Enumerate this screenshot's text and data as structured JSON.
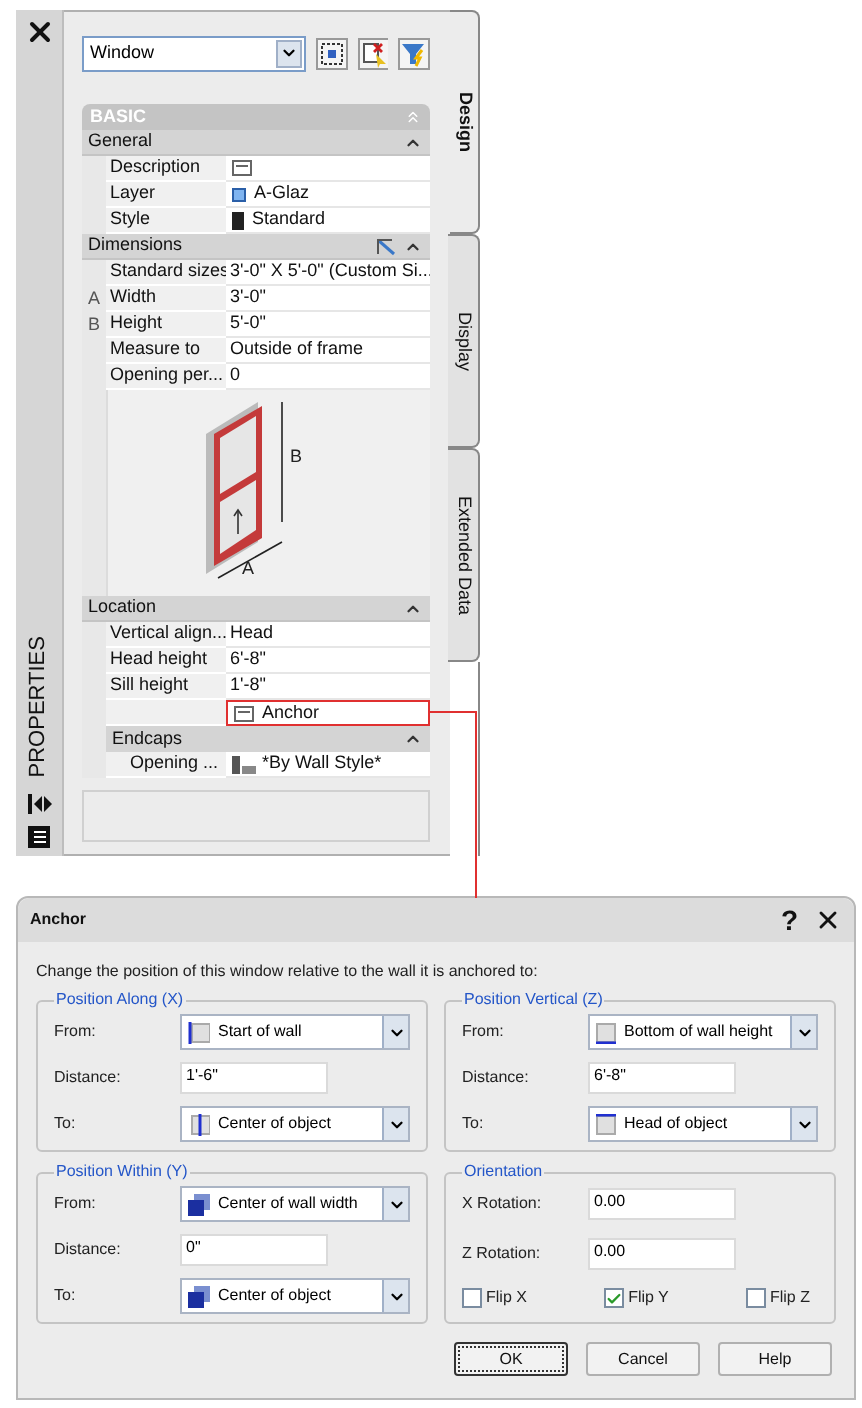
{
  "palette": {
    "title": "PROPERTIES",
    "object_type": "Window",
    "tabs": [
      {
        "label": "Design",
        "selected": true
      },
      {
        "label": "Display",
        "selected": false
      },
      {
        "label": "Extended Data",
        "selected": false
      }
    ],
    "section": {
      "title": "BASIC",
      "expanded": true
    },
    "groups": [
      {
        "title": "General",
        "expanded": true,
        "rows": [
          {
            "kind": "note",
            "label": "Description"
          },
          {
            "kind": "layer",
            "label": "Layer",
            "value": "A-Glaz"
          },
          {
            "kind": "style",
            "label": "Style",
            "value": "Standard"
          }
        ]
      },
      {
        "title": "Dimensions",
        "expanded": true,
        "rows": [
          {
            "kind": "text",
            "label": "Standard sizes",
            "value": "3'-0\" X 5'-0\" (Custom Si..."
          },
          {
            "kind": "text",
            "marker": "A",
            "label": "Width",
            "value": "3'-0\""
          },
          {
            "kind": "text",
            "marker": "B",
            "label": "Height",
            "value": "5'-0\""
          },
          {
            "kind": "text",
            "label": "Measure to",
            "value": "Outside of frame"
          },
          {
            "kind": "text",
            "label": "Opening per...",
            "value": "0"
          },
          {
            "kind": "image",
            "width_label": "A",
            "height_label": "B"
          }
        ]
      },
      {
        "title": "Location",
        "expanded": true,
        "rows": [
          {
            "kind": "text",
            "label": "Vertical align...",
            "value": "Head"
          },
          {
            "kind": "text",
            "label": "Head height",
            "value": "6'-8\""
          },
          {
            "kind": "text",
            "label": "Sill height",
            "value": "1'-8\""
          },
          {
            "kind": "anchor",
            "value": "Anchor",
            "highlighted": true
          }
        ],
        "subgroups": [
          {
            "title": "Endcaps",
            "expanded": true,
            "rows": [
              {
                "kind": "endcap",
                "label": "Opening ...",
                "value": "*By Wall Style*"
              }
            ]
          }
        ]
      }
    ]
  },
  "dialog": {
    "title": "Anchor",
    "help": "?",
    "instruction": "Change the position of this window relative to the wall it is anchored to:",
    "groups": [
      {
        "title": "Position Along (X)",
        "fields": [
          {
            "kind": "select",
            "label": "From:",
            "value": "Start of wall"
          },
          {
            "kind": "input",
            "label": "Distance:",
            "value": "1'-6\""
          },
          {
            "kind": "select",
            "label": "To:",
            "value": "Center of object"
          }
        ]
      },
      {
        "title": "Position Vertical (Z)",
        "fields": [
          {
            "kind": "select",
            "label": "From:",
            "value": "Bottom of wall height"
          },
          {
            "kind": "input",
            "label": "Distance:",
            "value": "6'-8\""
          },
          {
            "kind": "select",
            "label": "To:",
            "value": "Head of object"
          }
        ]
      },
      {
        "title": "Position Within (Y)",
        "fields": [
          {
            "kind": "select",
            "label": "From:",
            "value": "Center of wall width"
          },
          {
            "kind": "input",
            "label": "Distance:",
            "value": "0\""
          },
          {
            "kind": "select",
            "label": "To:",
            "value": "Center of object"
          }
        ]
      },
      {
        "title": "Orientation",
        "fields": [
          {
            "kind": "input",
            "label": "X Rotation:",
            "value": "0.00"
          },
          {
            "kind": "input",
            "label": "Z Rotation:",
            "value": "0.00"
          }
        ],
        "checkboxes": [
          {
            "label": "Flip X",
            "checked": false
          },
          {
            "label": "Flip Y",
            "checked": true
          },
          {
            "label": "Flip Z",
            "checked": false
          }
        ]
      }
    ],
    "buttons": [
      {
        "label": "OK",
        "default": true
      },
      {
        "label": "Cancel",
        "default": false
      },
      {
        "label": "Help",
        "default": false
      }
    ]
  }
}
